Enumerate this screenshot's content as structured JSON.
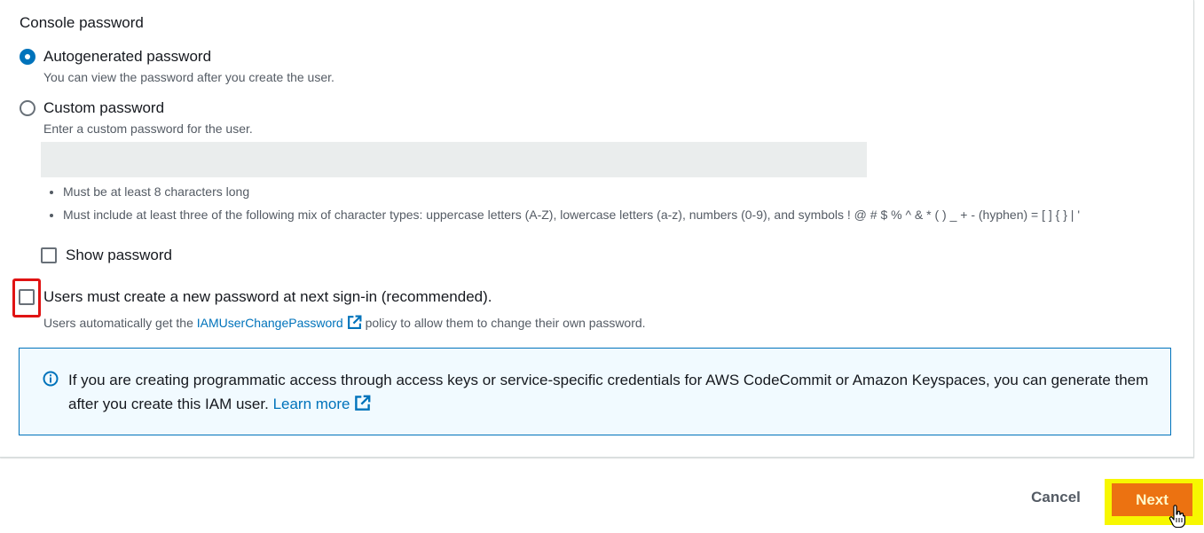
{
  "section": {
    "title": "Console password"
  },
  "options": {
    "autogenerated": {
      "label": "Autogenerated password",
      "description": "You can view the password after you create the user.",
      "selected": true
    },
    "custom": {
      "label": "Custom password",
      "description": "Enter a custom password for the user.",
      "selected": false,
      "input_value": "",
      "input_placeholder": ""
    }
  },
  "rules": [
    "Must be at least 8 characters long",
    "Must include at least three of the following mix of character types: uppercase letters (A-Z), lowercase letters (a-z), numbers (0-9), and symbols ! @ # $ % ^ & * ( ) _ + - (hyphen) = [ ] { } | '"
  ],
  "show_password": {
    "label": "Show password",
    "checked": false
  },
  "require_reset": {
    "label": "Users must create a new password at next sign-in (recommended).",
    "checked": false,
    "desc_before": "Users automatically get the",
    "link": "IAMUserChangePassword",
    "desc_after": "policy to allow them to change their own password."
  },
  "info": {
    "text": "If you are creating programmatic access through access keys or service-specific credentials for AWS CodeCommit or Amazon Keyspaces, you can generate them after you create this IAM user.",
    "link": "Learn more"
  },
  "footer": {
    "cancel": "Cancel",
    "next": "Next"
  },
  "colors": {
    "accent": "#0073bb",
    "primary_button": "#ec7211",
    "highlight_red": "#e01313",
    "highlight_yellow": "#f7f700",
    "info_bg": "#f1faff"
  },
  "icons": [
    "external-link-icon",
    "info-icon",
    "hand-pointer-cursor"
  ]
}
